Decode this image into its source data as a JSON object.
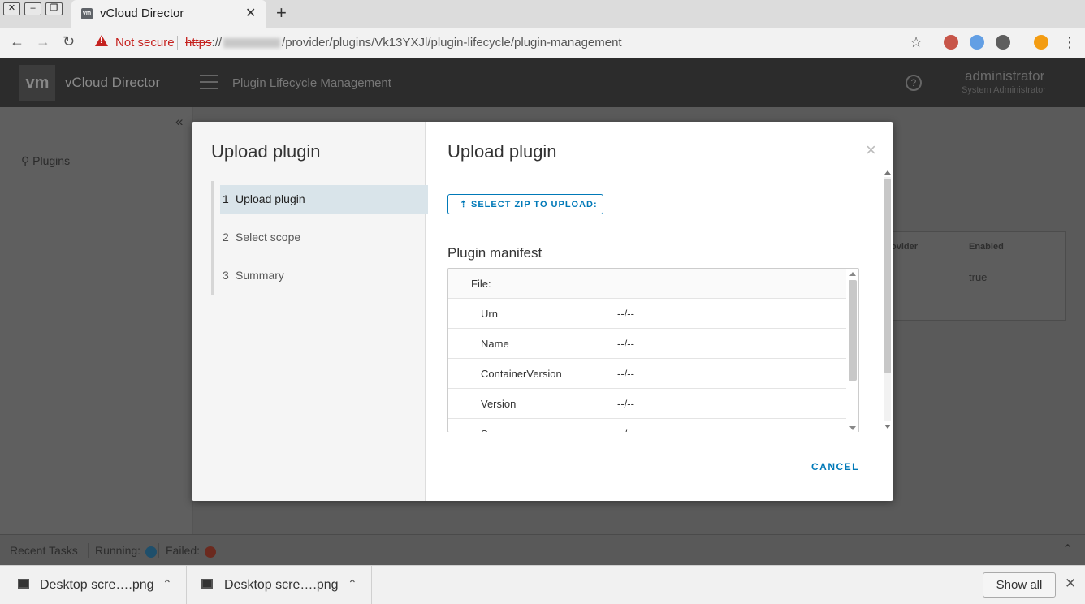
{
  "browser": {
    "tab_title": "vCloud Director",
    "tab_favicon": "vm",
    "security_label": "Not secure",
    "url_scheme": "https",
    "url_sep": "://",
    "url_path": "/provider/plugins/Vk13YXJl/plugin-lifecycle/plugin-management",
    "extension_colors": [
      "#c0392b",
      "#4a90e2",
      "#444444",
      "#f39c12"
    ]
  },
  "app": {
    "logo": "vm",
    "brand": "vCloud Director",
    "page_title": "Plugin Lifecycle Management",
    "help": "?",
    "user_name": "administrator",
    "user_role": "System Administrator",
    "sidebar_item": "Plugins",
    "table_headers": [
      "ovider",
      "Enabled"
    ],
    "table_value": "true"
  },
  "tasks_bar": {
    "label": "Recent Tasks",
    "running_label": "Running:",
    "failed_label": "Failed:",
    "running_color": "#0079b8",
    "failed_color": "#c92100"
  },
  "modal": {
    "nav_title": "Upload plugin",
    "steps": [
      {
        "num": "1",
        "label": "Upload plugin",
        "active": true
      },
      {
        "num": "2",
        "label": "Select scope",
        "active": false
      },
      {
        "num": "3",
        "label": "Summary",
        "active": false
      }
    ],
    "content_title": "Upload plugin",
    "close_icon": "×",
    "upload_button": "SELECT ZIP TO UPLOAD:",
    "manifest_title": "Plugin manifest",
    "manifest_file_label": "File:",
    "manifest_rows": [
      {
        "key": "Urn",
        "value": "--/--"
      },
      {
        "key": "Name",
        "value": "--/--"
      },
      {
        "key": "ContainerVersion",
        "value": "--/--"
      },
      {
        "key": "Version",
        "value": "--/--"
      },
      {
        "key": "Scope",
        "value": "--/--"
      }
    ],
    "cancel_button": "CANCEL"
  },
  "downloads": {
    "items": [
      {
        "name": "Desktop scre….png"
      },
      {
        "name": "Desktop scre….png"
      }
    ],
    "show_all": "Show all"
  }
}
